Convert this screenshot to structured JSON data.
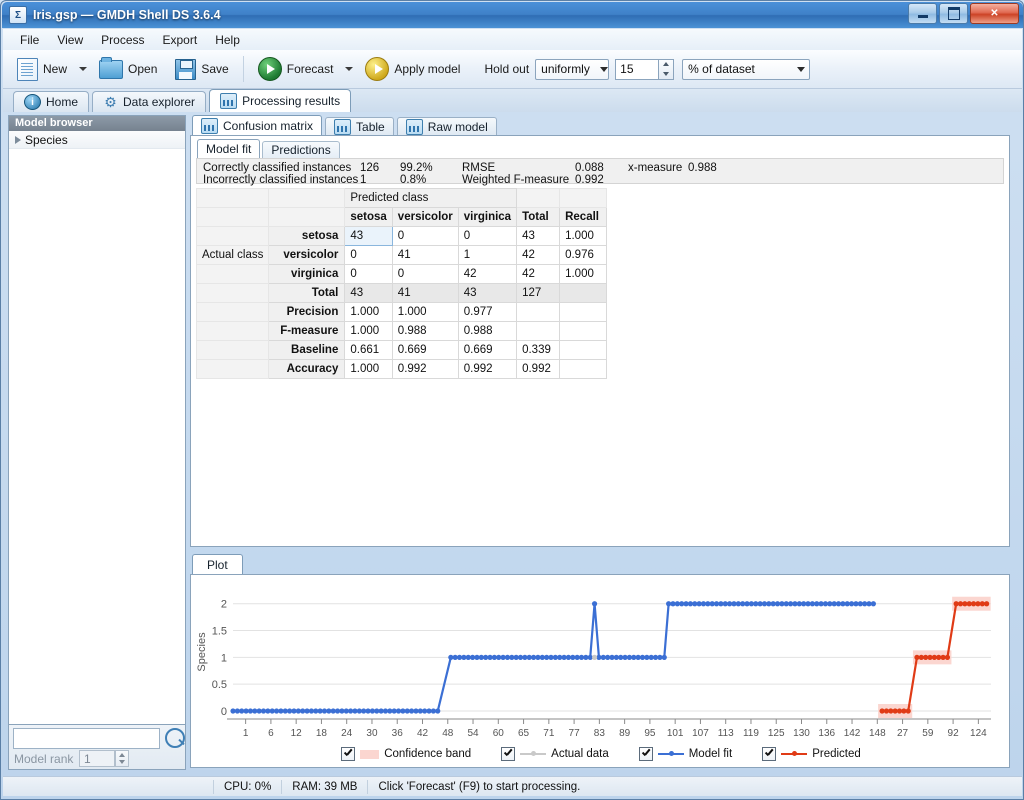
{
  "window": {
    "title": "Iris.gsp — GMDH Shell DS 3.6.4",
    "app_icon": "sigma-icon",
    "minimize_label": "Minimize",
    "maximize_label": "Maximize",
    "close_label": "Close"
  },
  "menu": {
    "items": [
      "File",
      "View",
      "Process",
      "Export",
      "Help"
    ]
  },
  "toolbar": {
    "new_label": "New",
    "open_label": "Open",
    "save_label": "Save",
    "forecast_label": "Forecast",
    "apply_model_label": "Apply model",
    "holdout_label": "Hold out",
    "holdout_mode": "uniformly",
    "holdout_value": "15",
    "holdout_unit": "% of dataset"
  },
  "main_tabs": [
    {
      "label": "Home",
      "icon": "info-icon",
      "active": false
    },
    {
      "label": "Data explorer",
      "icon": "gear-icon",
      "active": false
    },
    {
      "label": "Processing results",
      "icon": "chart-icon",
      "active": true
    }
  ],
  "sidebar": {
    "title": "Model browser",
    "items": [
      {
        "label": "Species"
      }
    ],
    "search_placeholder": "",
    "search_value": "",
    "rank_label": "Model rank",
    "rank_value": "1"
  },
  "results": {
    "tabs": [
      {
        "label": "Confusion matrix",
        "active": true
      },
      {
        "label": "Table",
        "active": false
      },
      {
        "label": "Raw model",
        "active": false
      }
    ],
    "subtabs": [
      {
        "label": "Model fit",
        "active": true
      },
      {
        "label": "Predictions",
        "active": false
      }
    ],
    "metrics": {
      "correct_label": "Correctly classified instances",
      "correct_count": "126",
      "correct_pct": "99.2%",
      "incorrect_label": "Incorrectly classified instances",
      "incorrect_count": "1",
      "incorrect_pct": "0.8%",
      "rmse_label": "RMSE",
      "rmse_value": "0.088",
      "wfm_label": "Weighted F-measure",
      "wfm_value": "0.992",
      "xmeasure_label": "x-measure",
      "xmeasure_value": "0.988"
    },
    "matrix": {
      "predicted_class_label": "Predicted class",
      "actual_class_label": "Actual class",
      "columns": [
        "setosa",
        "versicolor",
        "virginica",
        "Total",
        "Recall"
      ],
      "rows": [
        {
          "header": "setosa",
          "type": "class",
          "cells": [
            "43",
            "0",
            "0",
            "43",
            "1.000"
          ]
        },
        {
          "header": "versicolor",
          "type": "class",
          "cells": [
            "0",
            "41",
            "1",
            "42",
            "0.976"
          ]
        },
        {
          "header": "virginica",
          "type": "class",
          "cells": [
            "0",
            "0",
            "42",
            "42",
            "1.000"
          ]
        },
        {
          "header": "Total",
          "type": "total",
          "cells": [
            "43",
            "41",
            "43",
            "127",
            ""
          ]
        },
        {
          "header": "Precision",
          "type": "stat",
          "cells": [
            "1.000",
            "1.000",
            "0.977",
            "",
            ""
          ]
        },
        {
          "header": "F-measure",
          "type": "stat",
          "cells": [
            "1.000",
            "0.988",
            "0.988",
            "",
            ""
          ]
        },
        {
          "header": "Baseline",
          "type": "stat",
          "cells": [
            "0.661",
            "0.669",
            "0.669",
            "0.339",
            ""
          ]
        },
        {
          "header": "Accuracy",
          "type": "stat",
          "cells": [
            "1.000",
            "0.992",
            "0.992",
            "0.992",
            ""
          ]
        }
      ]
    }
  },
  "plot": {
    "tab_label": "Plot",
    "legend": [
      {
        "label": "Confidence band",
        "checked": true,
        "style": "band",
        "color": "#fbd6d0"
      },
      {
        "label": "Actual data",
        "checked": true,
        "style": "line",
        "color": "#c9c9c9"
      },
      {
        "label": "Model fit",
        "checked": true,
        "style": "line",
        "color": "#3b6fd4"
      },
      {
        "label": "Predicted",
        "checked": true,
        "style": "line",
        "color": "#e03b16"
      }
    ]
  },
  "chart_data": {
    "type": "line",
    "title": "",
    "xlabel": "",
    "ylabel": "Species",
    "ylim": [
      0,
      2.2
    ],
    "yticks": [
      "0",
      "0.5",
      "1",
      "1.5",
      "2"
    ],
    "grid": true,
    "legend_position": "bottom",
    "xticks": [
      "1",
      "6",
      "12",
      "18",
      "24",
      "30",
      "36",
      "42",
      "48",
      "54",
      "60",
      "65",
      "71",
      "77",
      "83",
      "89",
      "95",
      "101",
      "107",
      "113",
      "119",
      "125",
      "130",
      "136",
      "142",
      "148",
      "27",
      "59",
      "92",
      "124"
    ],
    "n_points": 148,
    "series": [
      {
        "name": "Model fit",
        "color": "#3b6fd4",
        "segments": [
          {
            "from": 1,
            "to": 48,
            "value": 0
          },
          {
            "from": 51,
            "to": 83,
            "value": 1
          },
          {
            "from": 84,
            "to": 84,
            "value": 2
          },
          {
            "from": 85,
            "to": 100,
            "value": 1
          },
          {
            "from": 101,
            "to": 148,
            "value": 2
          }
        ]
      },
      {
        "name": "Actual data",
        "color": "#c9c9c9",
        "segments": [
          {
            "from": 84,
            "to": 84,
            "value": 1
          }
        ]
      },
      {
        "name": "Predicted",
        "color": "#e03b16",
        "segments": [
          {
            "from": 150,
            "to": 156,
            "value": 0
          },
          {
            "from": 158,
            "to": 165,
            "value": 1
          },
          {
            "from": 167,
            "to": 174,
            "value": 2
          }
        ]
      }
    ],
    "confidence_band": {
      "color": "#fbd6d0",
      "applies_to": "Predicted"
    }
  },
  "statusbar": {
    "cpu": "CPU: 0%",
    "ram": "RAM: 39 MB",
    "message": "Click 'Forecast' (F9) to start processing."
  }
}
